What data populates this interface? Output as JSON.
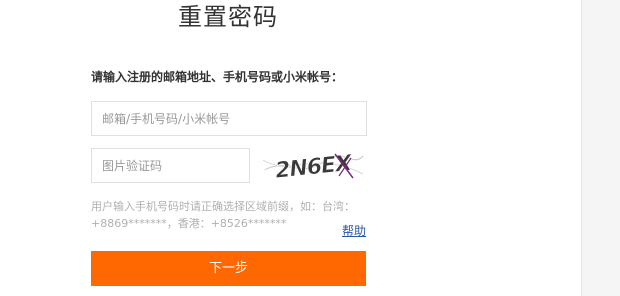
{
  "form": {
    "title": "重置密码",
    "prompt": "请输入注册的邮箱地址、手机号码或小米帐号：",
    "email_placeholder": "邮箱/手机号码/小米帐号",
    "captcha_placeholder": "图片验证码",
    "captcha_text": "2N6EX",
    "hint": "用户输入手机号码时请正确选择区域前缀，如：台湾：+8869*******，香港：+8526*******",
    "help_label": "帮助",
    "next_label": "下一步"
  },
  "colors": {
    "accent": "#ff6700",
    "link": "#2a58a8",
    "side_panel": "#f5f5f5"
  }
}
